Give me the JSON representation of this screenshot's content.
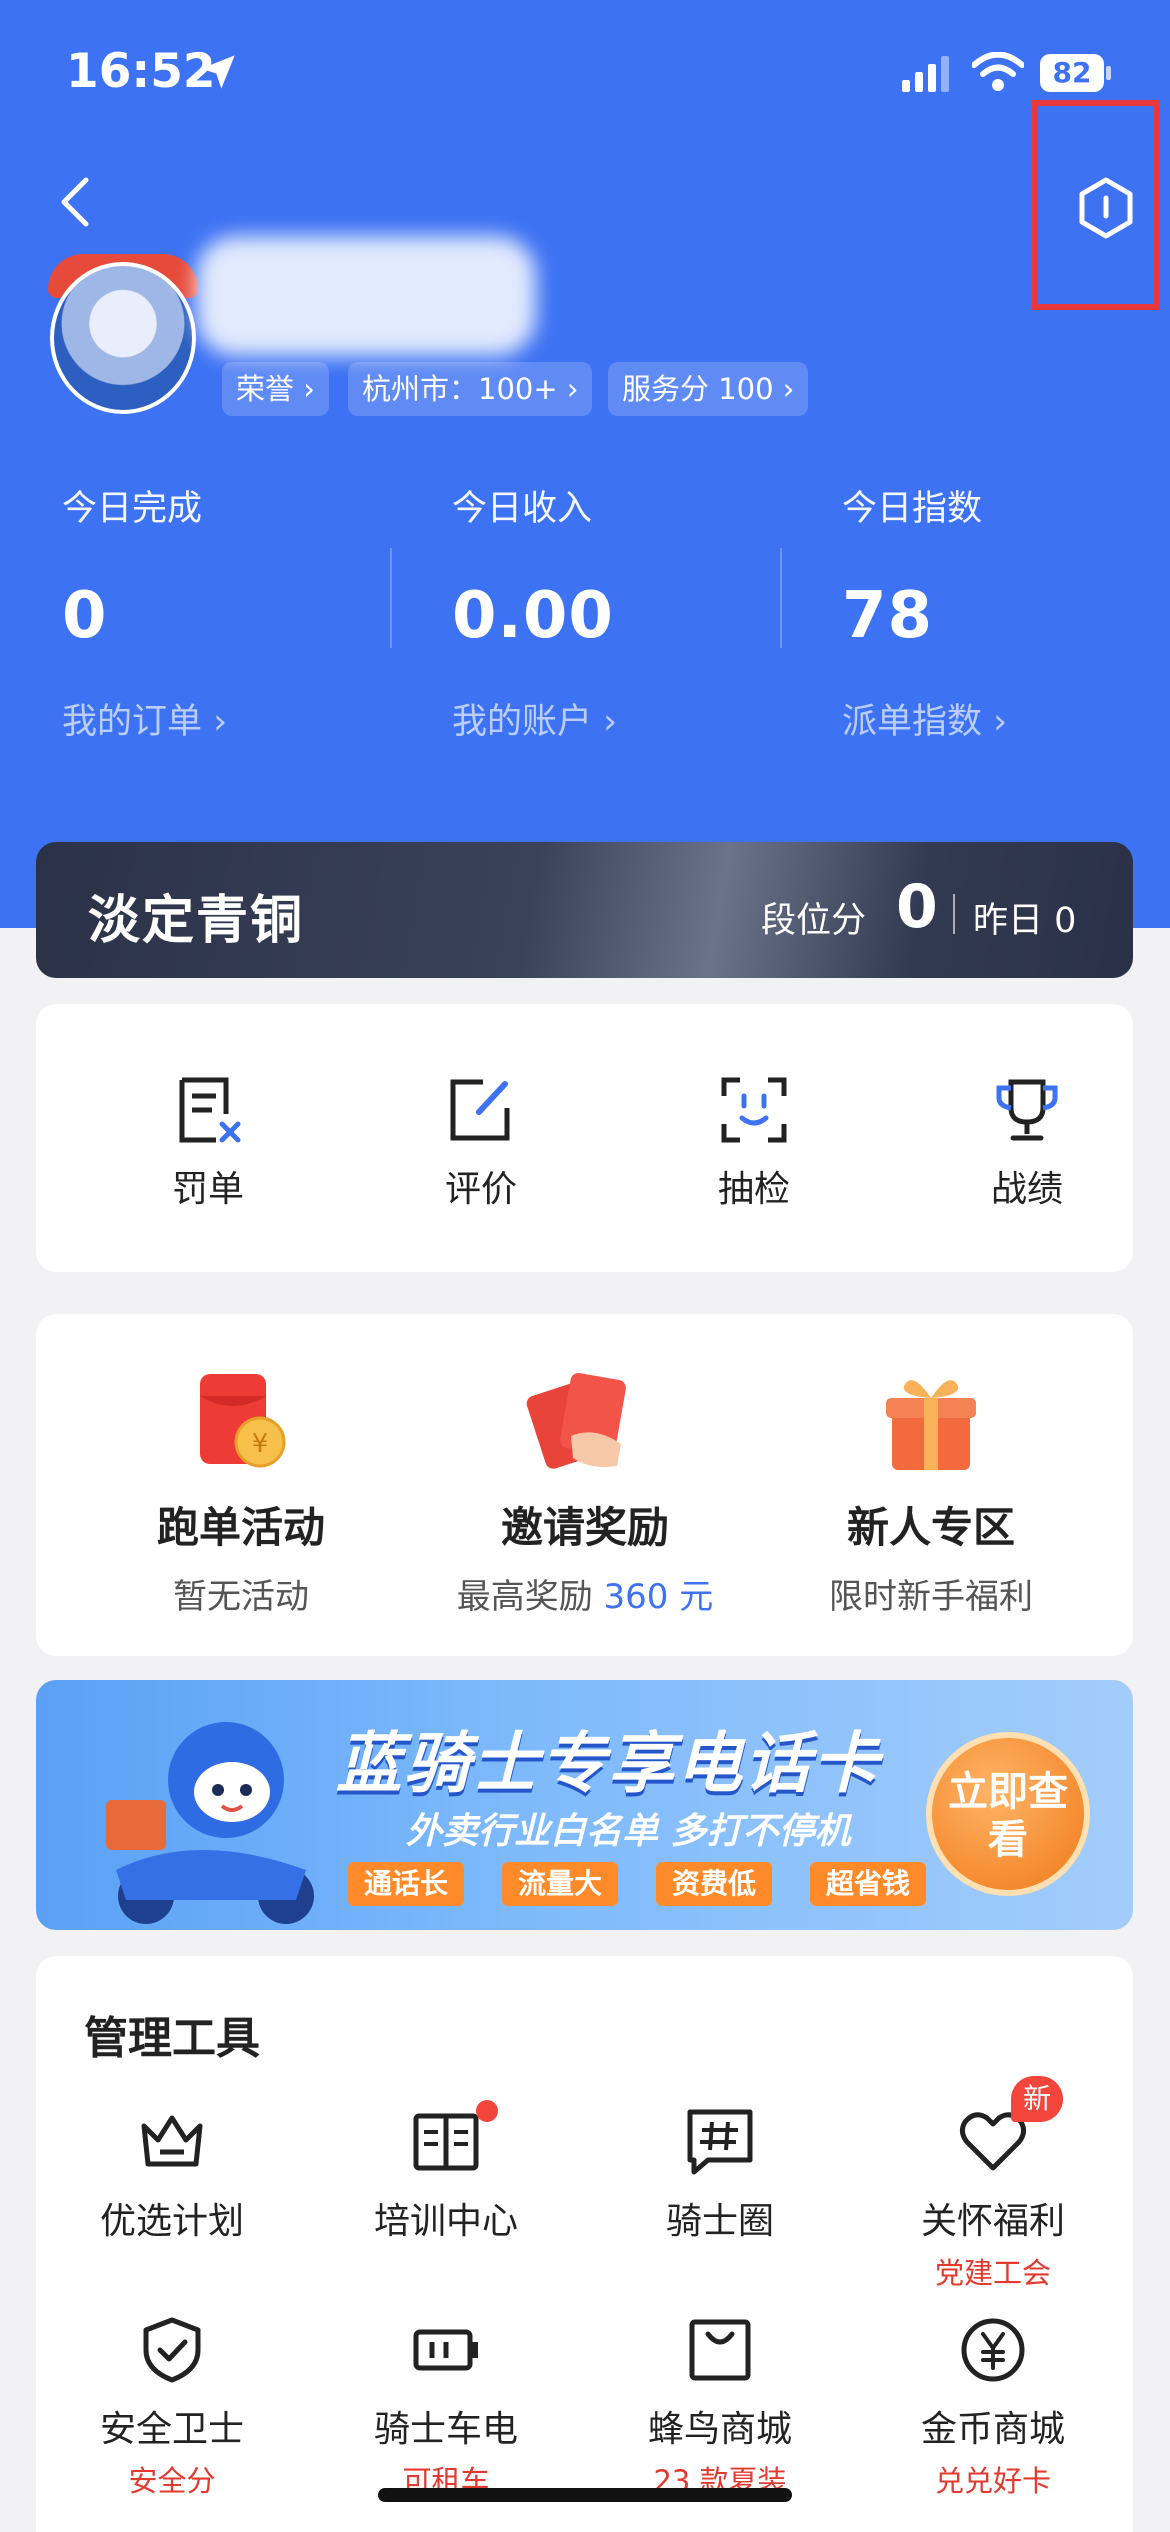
{
  "status_bar": {
    "time": "16:52",
    "battery": "82"
  },
  "profile": {
    "chips": [
      "荣誉 ›",
      "杭州市：100+ ›",
      "服务分 100 ›"
    ]
  },
  "stats": [
    {
      "label": "今日完成",
      "value": "0",
      "link": "我的订单 ›"
    },
    {
      "label": "今日收入",
      "value": "0.00",
      "link": "我的账户 ›"
    },
    {
      "label": "今日指数",
      "value": "78",
      "link": "派单指数 ›"
    }
  ],
  "rank": {
    "title": "淡定青铜",
    "segment_label": "段位分",
    "segment_value": "0",
    "yesterday": "昨日 0"
  },
  "quick_tools": [
    {
      "label": "罚单",
      "icon": "penalty-icon"
    },
    {
      "label": "评价",
      "icon": "edit-icon"
    },
    {
      "label": "抽检",
      "icon": "face-scan-icon"
    },
    {
      "label": "战绩",
      "icon": "trophy-icon"
    }
  ],
  "promos": [
    {
      "title": "跑单活动",
      "sub": "暂无活动",
      "icon": "red-envelope-icon"
    },
    {
      "title": "邀请奖励",
      "sub_prefix": "最高奖励 ",
      "sub_highlight": "360 元",
      "icon": "red-envelopes-icon"
    },
    {
      "title": "新人专区",
      "sub": "限时新手福利",
      "icon": "gift-icon"
    }
  ],
  "banner": {
    "headline": "蓝骑士专享电话卡",
    "subline": "外卖行业白名单 多打不停机",
    "tags": [
      "通话长",
      "流量大",
      "资费低",
      "超省钱"
    ],
    "cta": "立即查看"
  },
  "management": {
    "title": "管理工具",
    "items": [
      {
        "label": "优选计划",
        "sub": "",
        "icon": "crown-icon"
      },
      {
        "label": "培训中心",
        "sub": "",
        "icon": "book-icon"
      },
      {
        "label": "骑士圈",
        "sub": "",
        "icon": "hash-chat-icon"
      },
      {
        "label": "关怀福利",
        "sub": "党建工会",
        "icon": "heart-icon",
        "badge": "新"
      },
      {
        "label": "安全卫士",
        "sub": "安全分",
        "icon": "shield-icon"
      },
      {
        "label": "骑士车电",
        "sub": "可租车",
        "icon": "battery-icon"
      },
      {
        "label": "蜂鸟商城",
        "sub": "23 款夏装",
        "icon": "shopping-bag-icon"
      },
      {
        "label": "金币商城",
        "sub": "兑兑好卡",
        "icon": "coin-icon"
      }
    ]
  },
  "colors": {
    "brand_blue": "#3d72f3",
    "alert_red": "#e23a2f",
    "highlight_border": "#e8383d"
  }
}
